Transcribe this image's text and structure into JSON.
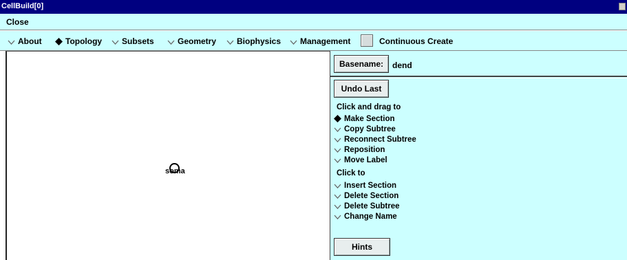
{
  "window": {
    "title": "CellBuild[0]"
  },
  "menubar": {
    "close_label": "Close"
  },
  "toolbar": {
    "items": [
      {
        "label": "About",
        "selected": false
      },
      {
        "label": "Topology",
        "selected": true
      },
      {
        "label": "Subsets",
        "selected": false
      },
      {
        "label": "Geometry",
        "selected": false
      },
      {
        "label": "Biophysics",
        "selected": false
      },
      {
        "label": "Management",
        "selected": false
      }
    ],
    "continuous_create_label": "Continuous Create",
    "continuous_create_checked": false
  },
  "canvas": {
    "soma_label": "soma"
  },
  "panel": {
    "basename_button": "Basename:",
    "basename_value": "dend",
    "undo_button": "Undo Last",
    "drag_heading": "Click and drag to",
    "drag_options": [
      {
        "label": "Make Section",
        "selected": true
      },
      {
        "label": "Copy Subtree",
        "selected": false
      },
      {
        "label": "Reconnect Subtree",
        "selected": false
      },
      {
        "label": "Reposition",
        "selected": false
      },
      {
        "label": "Move Label",
        "selected": false
      }
    ],
    "click_heading": "Click to",
    "click_options": [
      {
        "label": "Insert Section",
        "selected": false
      },
      {
        "label": "Delete Section",
        "selected": false
      },
      {
        "label": "Delete Subtree",
        "selected": false
      },
      {
        "label": "Change Name",
        "selected": false
      }
    ],
    "hints_button": "Hints"
  }
}
